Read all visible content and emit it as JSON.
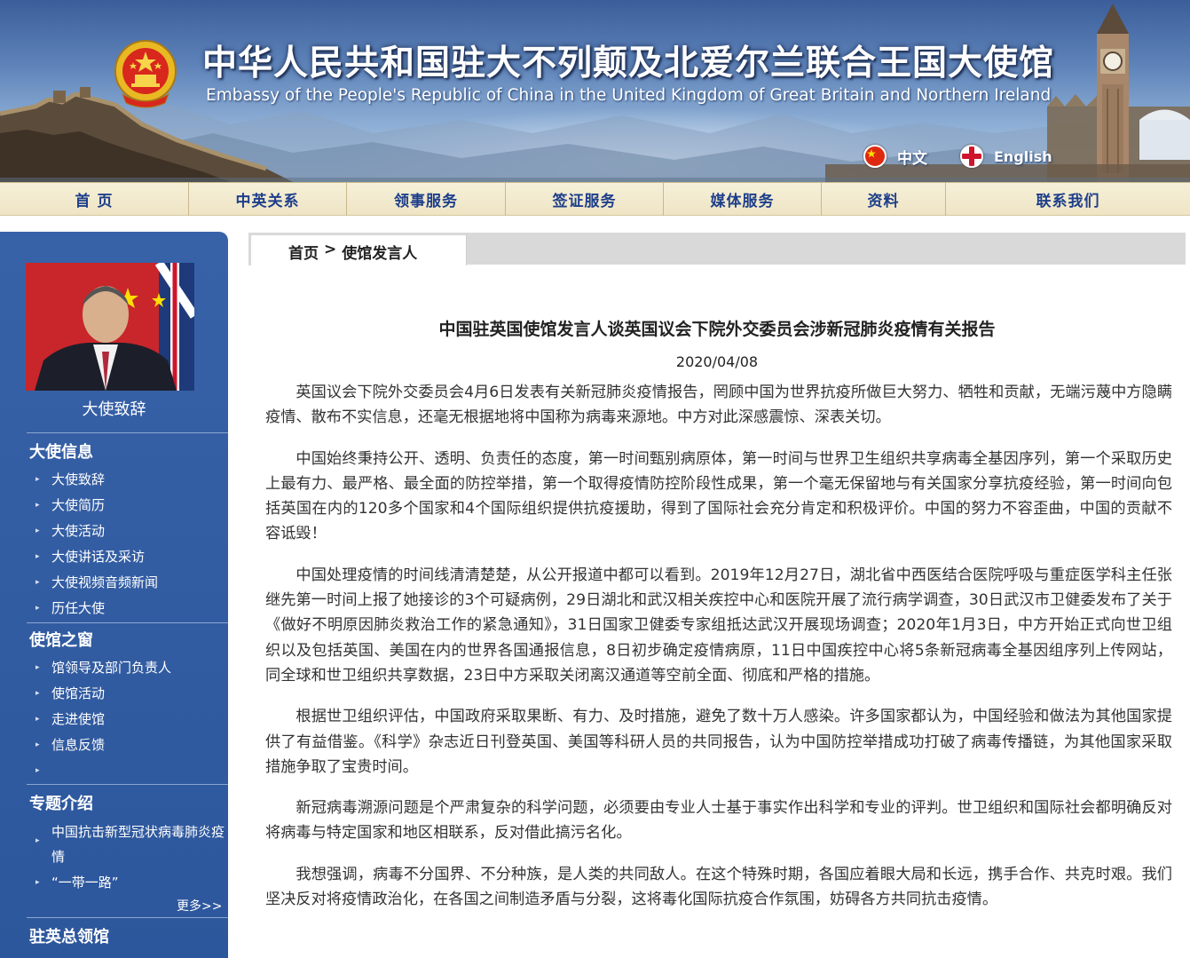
{
  "header": {
    "title_cn": "中华人民共和国驻大不列颠及北爱尔兰联合王国大使馆",
    "title_en": "Embassy of the People's Republic of China in the United Kingdom of Great Britain and Northern Ireland",
    "lang_cn": "中文",
    "lang_en": "English"
  },
  "nav": {
    "items": [
      "首 页",
      "中英关系",
      "领事服务",
      "签证服务",
      "媒体服务",
      "资料",
      "联系我们"
    ]
  },
  "sidebar": {
    "photo_caption": "大使致辞",
    "sections": [
      {
        "heading": "大使信息",
        "links": [
          "大使致辞",
          "大使简历",
          "大使活动",
          "大使讲话及采访",
          "大使视频音频新闻",
          "历任大使"
        ]
      },
      {
        "heading": "使馆之窗",
        "links": [
          "馆领导及部门负责人",
          "使馆活动",
          "走进使馆",
          "信息反馈",
          ""
        ]
      },
      {
        "heading": "专题介绍",
        "links": [
          "中国抗击新型冠状病毒肺炎疫情",
          "“一带一路”"
        ]
      },
      {
        "heading": "驻英总领馆"
      }
    ],
    "more": "更多>>"
  },
  "breadcrumb": {
    "home": "首页",
    "sep": ">",
    "current": "使馆发言人"
  },
  "article": {
    "title": "中国驻英国使馆发言人谈英国议会下院外交委员会涉新冠肺炎疫情有关报告",
    "date": "2020/04/08",
    "paragraphs": [
      "英国议会下院外交委员会4月6日发表有关新冠肺炎疫情报告，罔顾中国为世界抗疫所做巨大努力、牺牲和贡献，无端污蔑中方隐瞒疫情、散布不实信息，还毫无根据地将中国称为病毒来源地。中方对此深感震惊、深表关切。",
      "中国始终秉持公开、透明、负责任的态度，第一时间甄别病原体，第一时间与世界卫生组织共享病毒全基因序列，第一个采取历史上最有力、最严格、最全面的防控举措，第一个取得疫情防控阶段性成果，第一个毫无保留地与有关国家分享抗疫经验，第一时间向包括英国在内的120多个国家和4个国际组织提供抗疫援助，得到了国际社会充分肯定和积极评价。中国的努力不容歪曲，中国的贡献不容诋毁！",
      "中国处理疫情的时间线清清楚楚，从公开报道中都可以看到。2019年12月27日，湖北省中西医结合医院呼吸与重症医学科主任张继先第一时间上报了她接诊的3个可疑病例，29日湖北和武汉相关疾控中心和医院开展了流行病学调查，30日武汉市卫健委发布了关于《做好不明原因肺炎救治工作的紧急通知》，31日国家卫健委专家组抵达武汉开展现场调查；2020年1月3日，中方开始正式向世卫组织以及包括英国、美国在内的世界各国通报信息，8日初步确定疫情病原，11日中国疾控中心将5条新冠病毒全基因组序列上传网站，同全球和世卫组织共享数据，23日中方采取关闭离汉通道等空前全面、彻底和严格的措施。",
      "根据世卫组织评估，中国政府采取果断、有力、及时措施，避免了数十万人感染。许多国家都认为，中国经验和做法为其他国家提供了有益借鉴。《科学》杂志近日刊登英国、美国等科研人员的共同报告，认为中国防控举措成功打破了病毒传播链，为其他国家采取措施争取了宝贵时间。",
      "新冠病毒溯源问题是个严肃复杂的科学问题，必须要由专业人士基于事实作出科学和专业的评判。世卫组织和国际社会都明确反对将病毒与特定国家和地区相联系，反对借此搞污名化。",
      "我想强调，病毒不分国界、不分种族，是人类的共同敌人。在这个特殊时期，各国应着眼大局和长远，携手合作、共克时艰。我们坚决反对将疫情政治化，在各国之间制造矛盾与分裂，这将毒化国际抗疫合作氛围，妨碍各方共同抗击疫情。"
    ]
  },
  "colors": {
    "nav_text": "#1e3f8a",
    "sidebar_bg": "#2f5aa0",
    "nav_bg": "#f3ebd0",
    "crumb_bg": "#d9d9d9"
  },
  "icons": [
    "national-emblem-icon",
    "china-flag-icon",
    "uk-flag-icon",
    "chevron-right-icon"
  ]
}
